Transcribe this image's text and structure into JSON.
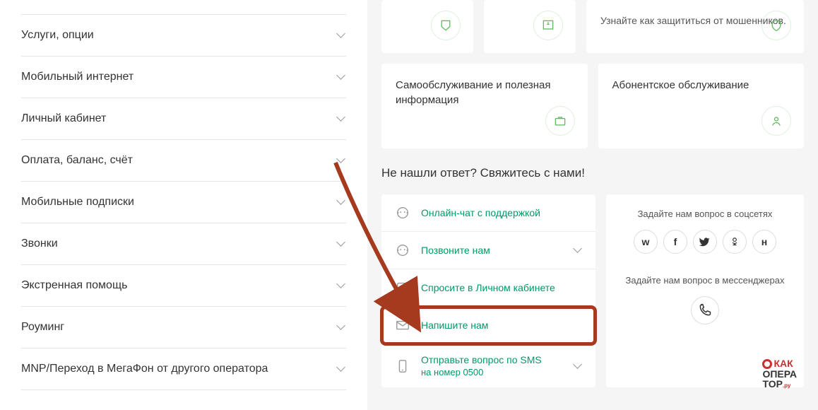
{
  "menu": {
    "items": [
      "Услуги, опции",
      "Мобильный интернет",
      "Личный кабинет",
      "Оплата, баланс, счёт",
      "Мобильные подписки",
      "Звонки",
      "Экстренная помощь",
      "Роуминг",
      "MNP/Переход в МегаФон от другого оператора"
    ]
  },
  "cards_top": {
    "fraud": "Узнайте как защититься от мошенников."
  },
  "cards_bottom": {
    "self_service": "Самообслуживание и полезная информация",
    "subscriber": "Абонентское обслуживание"
  },
  "contact": {
    "title": "Не нашли ответ? Свяжитесь с нами!",
    "items": {
      "chat": "Онлайн-чат с поддержкой",
      "call": "Позвоните нам",
      "ask": "Спросите в Личном кабинете",
      "write": "Напишите нам",
      "sms": "Отправьте вопрос по SMS",
      "sms_sub": "на номер 0500"
    }
  },
  "social": {
    "title": "Задайте нам вопрос в соцсетях",
    "messenger_title": "Задайте нам вопрос в мессенджерах",
    "icons": {
      "vk": "w",
      "fb": "f",
      "tw": "🐦",
      "ok": "ok",
      "h": "н"
    }
  },
  "watermark": {
    "line1": "КАК",
    "line2": "ОПЕРА",
    "line3": "ТОР"
  }
}
